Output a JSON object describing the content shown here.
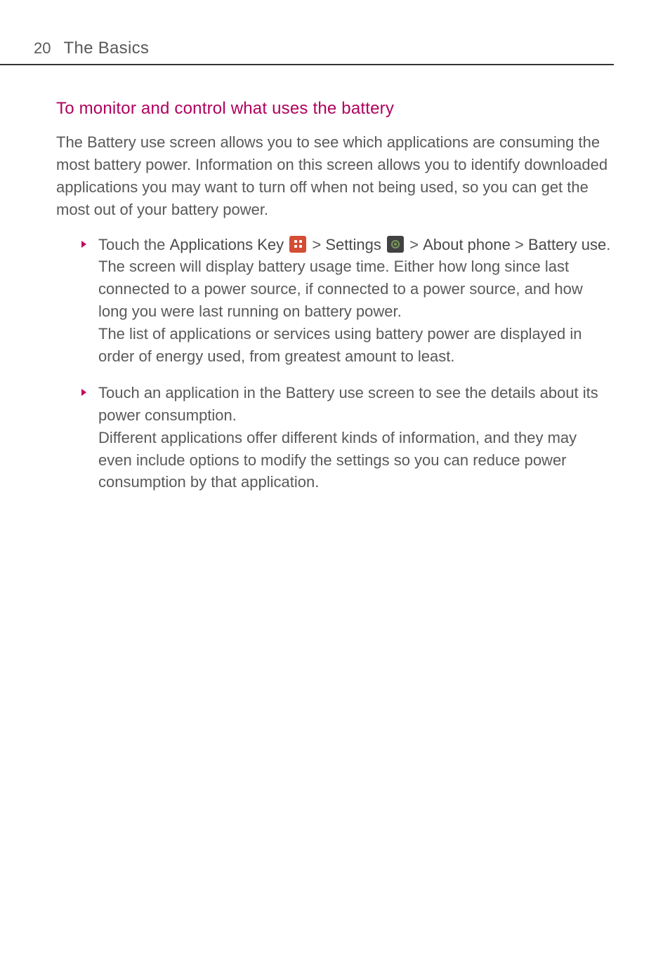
{
  "header": {
    "page_number": "20",
    "title": "The Basics"
  },
  "section": {
    "heading": "To monitor and control what uses the battery",
    "intro": "The Battery use screen allows you to see which applications are consuming the most battery power. Information on this screen allows you to identify downloaded applications you may want to turn off when not being used, so you can get the most out of your battery power."
  },
  "bullets": [
    {
      "p1_prefix": "Touch the ",
      "apps_key": "Applications Key",
      "gt1": " > ",
      "settings": "Settings",
      "gt2": " > ",
      "about_phone": "About phone",
      "gt3": " > ",
      "battery_use": "Battery use",
      "p1_suffix": ". The screen will display battery usage time. Either how long since last connected to a power source, if connected to a power source, and how long you were last running on battery power.",
      "p2": "The list of applications or services using battery power are displayed in order of energy used, from greatest amount to least."
    },
    {
      "p1": "Touch an application in the Battery use screen to see the details about its power consumption.",
      "p2": "Different applications offer different kinds of information, and they may even include options to modify the settings so you can reduce power consumption by that application."
    }
  ]
}
